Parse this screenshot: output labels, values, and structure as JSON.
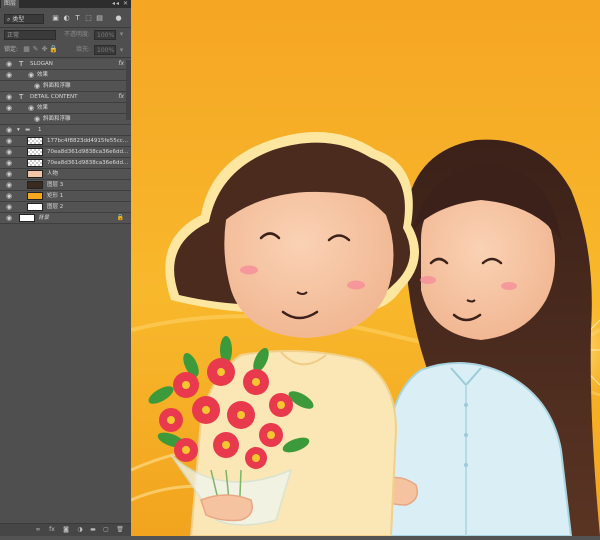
{
  "panel": {
    "tab_label": "图层",
    "window_controls": "◂◂ ✕",
    "filter_kind": "⌕ 类型",
    "blend_mode": "正常",
    "opacity_label": "不透明度:",
    "opacity_value": "100%",
    "lock_label": "锁定:",
    "fill_label": "填充:",
    "fill_value": "100%"
  },
  "layers": [
    {
      "name": "SLOGAN",
      "kind": "text",
      "indent": 0,
      "fx": "fx"
    },
    {
      "name": "效果",
      "kind": "effect-group",
      "indent": 1
    },
    {
      "name": "斜面和浮雕",
      "kind": "effect",
      "indent": 2
    },
    {
      "name": "DETAIL CONTENT",
      "kind": "text",
      "indent": 0,
      "fx": "fx"
    },
    {
      "name": "效果",
      "kind": "effect-group",
      "indent": 1
    },
    {
      "name": "斜面和浮雕",
      "kind": "effect",
      "indent": 2
    },
    {
      "name": "1",
      "kind": "group",
      "indent": 0
    },
    {
      "name": "177bc4f8823dd4915fe55cc...",
      "kind": "pixel-transparent",
      "indent": 1
    },
    {
      "name": "70ea8d361d9838ca36e6dd...",
      "kind": "pixel-transparent",
      "indent": 1
    },
    {
      "name": "70ea8d361d9838ca36e6dd...",
      "kind": "pixel-transparent",
      "indent": 1
    },
    {
      "name": "人物",
      "kind": "pixel-people",
      "indent": 1
    },
    {
      "name": "图层 3",
      "kind": "pixel-dark",
      "indent": 1
    },
    {
      "name": "矩形 1",
      "kind": "shape-orange",
      "indent": 1
    },
    {
      "name": "图层 2",
      "kind": "pixel-white",
      "indent": 1
    },
    {
      "name": "背景",
      "kind": "background",
      "indent": 0,
      "locked": true
    }
  ],
  "colors": {
    "panel_bg": "#535353",
    "canvas_orange": "#f4b021",
    "hair": "#4a2b1e",
    "skin": "#f6bf9b",
    "shirt_blue": "#d7eef4",
    "shirt_cream": "#fbe7b8",
    "flower_red": "#e83a4c",
    "leaf_green": "#3d9a3a"
  },
  "icons": {
    "bottom_bar": [
      "link-icon",
      "fx-icon",
      "mask-icon",
      "adjustment-icon",
      "folder-icon",
      "new-layer-icon",
      "trash-icon"
    ]
  }
}
